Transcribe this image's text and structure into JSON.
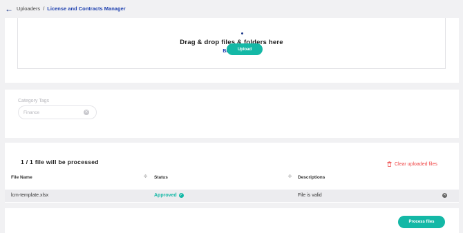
{
  "breadcrumb": {
    "root": "Uploaders",
    "separator": "/",
    "current": "License and Contracts Manager"
  },
  "upload": {
    "drop_title": "Drag & drop files & folders here",
    "browse_label": "Browse",
    "upload_label": "Upload"
  },
  "category": {
    "label": "Category Tags",
    "value": "Finance"
  },
  "processing": {
    "title": "1 / 1 file will be processed",
    "clear_label": "Clear uploaded files",
    "columns": [
      "File Name",
      "Status",
      "Descriptions"
    ],
    "rows": [
      {
        "file_name": "lcm-template.xlsx",
        "status": "Approved",
        "description": "File is valid"
      }
    ],
    "process_label": "Process files"
  },
  "colors": {
    "accent": "#14b8a6",
    "link": "#1e40af",
    "danger": "#ef4444",
    "background": "#f1f1f3"
  },
  "icons": {
    "back": "arrow-left-icon",
    "category_clear": "close-circle-icon",
    "trash": "trash-icon",
    "sort": "sort-icon",
    "status": "check-circle-icon",
    "remove": "remove-circle-icon"
  }
}
